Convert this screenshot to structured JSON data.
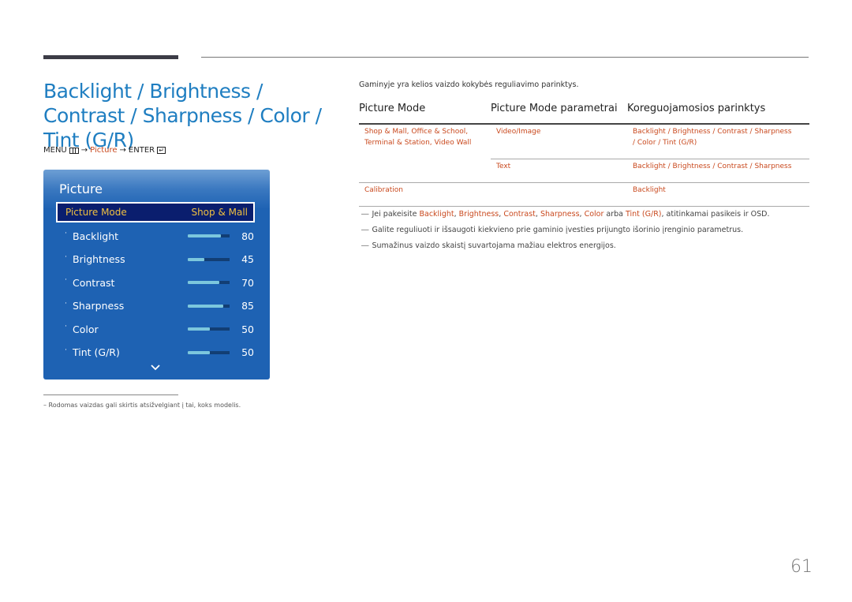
{
  "title": "Backlight / Brightness / Contrast / Sharpness / Color / Tint (G/R)",
  "menu_path": {
    "menu": "MENU",
    "arrow": "→",
    "item": "Picture",
    "enter": "ENTER",
    "enter_glyph": "↵"
  },
  "osd": {
    "title": "Picture",
    "picture_mode": {
      "label": "Picture Mode",
      "value": "Shop & Mall"
    },
    "items": [
      {
        "dot": "·",
        "label": "Backlight",
        "value": "80",
        "level": 0.8
      },
      {
        "dot": "·",
        "label": "Brightness",
        "value": "45",
        "level": 0.4
      },
      {
        "dot": "·",
        "label": "Contrast",
        "value": "70",
        "level": 0.75
      },
      {
        "dot": "·",
        "label": "Sharpness",
        "value": "85",
        "level": 0.85
      },
      {
        "dot": "·",
        "label": "Color",
        "value": "50",
        "level": 0.52
      },
      {
        "dot": "·",
        "label": "Tint (G/R)",
        "value": "50",
        "level": 0.52
      }
    ]
  },
  "footnote": "–  Rodomas vaizdas gali skirtis atsižvelgiant į tai, koks modelis.",
  "intro": "Gaminyje yra kelios vaizdo kokybės reguliavimo parinktys.",
  "table": {
    "headers": [
      "Picture Mode",
      "Picture Mode parametrai",
      "Koreguojamosios parinktys"
    ],
    "rows": [
      {
        "mode_line1": "Shop & Mall, Office & School,",
        "mode_line2": "Terminal & Station, Video Wall",
        "param": "Video/Image",
        "opts_line1": "Backlight / Brightness / Contrast / Sharpness",
        "opts_line2": "/ Color / Tint (G/R)"
      },
      {
        "mode_line1": "",
        "mode_line2": "",
        "param": "Text",
        "opts_line1": "Backlight / Brightness / Contrast / Sharpness",
        "opts_line2": ""
      },
      {
        "mode_line1": "Calibration",
        "mode_line2": "",
        "param": "",
        "opts_line1": "Backlight",
        "opts_line2": ""
      }
    ]
  },
  "notes": {
    "marker": "―",
    "n1": {
      "a": "Jei pakeisite ",
      "t1": "Backlight",
      "s1": ", ",
      "t2": "Brightness",
      "s2": ", ",
      "t3": "Contrast",
      "s3": ", ",
      "t4": "Sharpness",
      "s4": ", ",
      "t5": "Color",
      "s5": " arba ",
      "t6": "Tint (G/R)",
      "end": ", atitinkamai pasikeis ir OSD."
    },
    "n2": "Galite reguliuoti ir išsaugoti kiekvieno prie gaminio įvesties prijungto išorinio įrenginio parametrus.",
    "n3": "Sumažinus vaizdo skaistį suvartojama mažiau elektros energijos."
  },
  "page_number": "61"
}
